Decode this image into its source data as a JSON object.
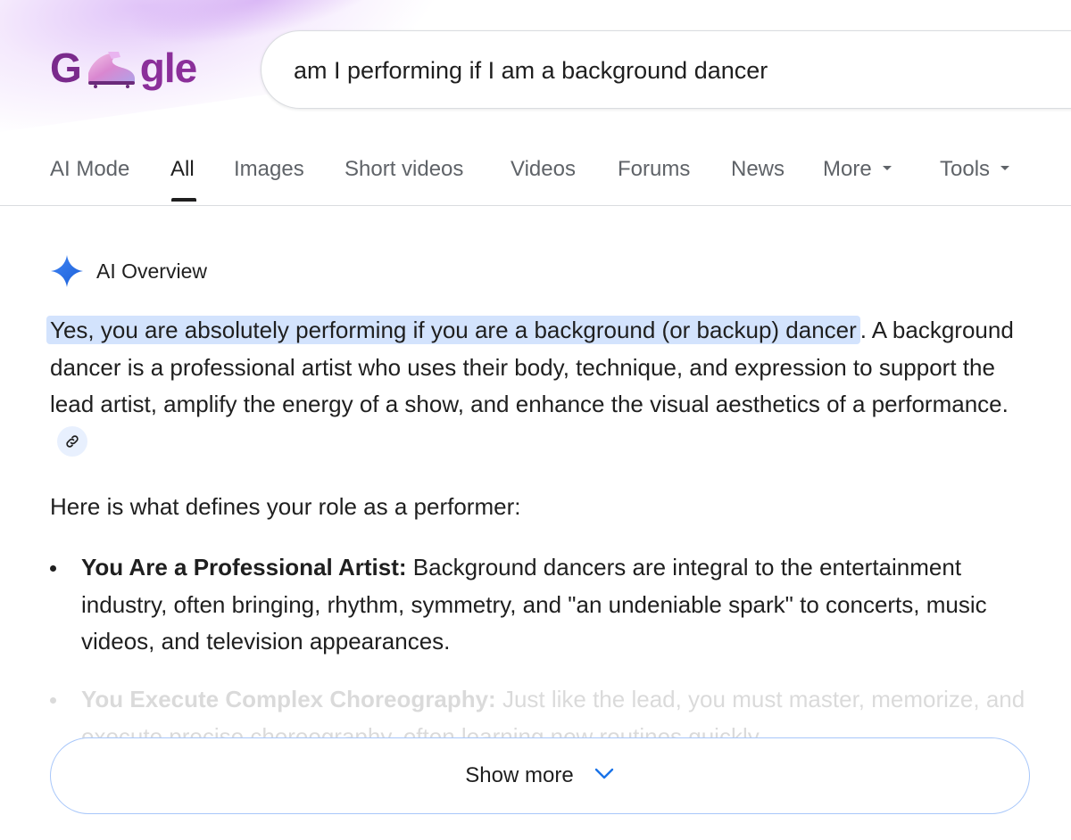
{
  "logo": {
    "part1": "G",
    "part2": "gle"
  },
  "search": {
    "query": "am I performing if I am a background dancer"
  },
  "tabs": [
    {
      "label": "AI Mode"
    },
    {
      "label": "All"
    },
    {
      "label": "Images"
    },
    {
      "label": "Short videos"
    },
    {
      "label": "Videos"
    },
    {
      "label": "Forums"
    },
    {
      "label": "News"
    },
    {
      "label": "More"
    },
    {
      "label": "Tools"
    }
  ],
  "active_tab": "All",
  "ai_overview": {
    "label": "AI Overview",
    "highlight": "Yes, you are absolutely performing if you are a background (or backup) dancer",
    "intro_rest": ". A background dancer is a professional artist who uses their body, technique, and expression to support the lead artist, amplify the energy of a show, and enhance the visual aesthetics of a performance.",
    "lead_in": "Here is what defines your role as a performer:",
    "bullets": [
      {
        "title": "You Are a Professional Artist:",
        "text": " Background dancers are integral to the entertainment industry, often bringing, rhythm, symmetry, and \"an undeniable spark\" to concerts, music videos, and television appearances."
      },
      {
        "title": "You Execute Complex Choreography:",
        "text": " Just like the lead, you must master, memorize, and execute precise choreography, often learning new routines quickly."
      }
    ],
    "show_more": "Show more"
  },
  "colors": {
    "highlight": "#d3e3fd",
    "accent_blue": "#1a73e8",
    "logo_purple": "#7a2a8c"
  }
}
